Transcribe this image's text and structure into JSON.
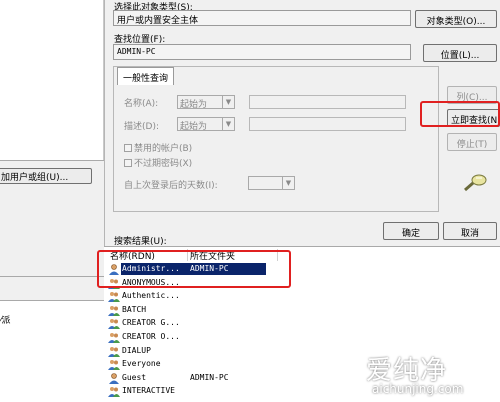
{
  "left_window": {
    "button_label": "加用户或组(U)...",
    "fragment_text": "⁄派"
  },
  "dialog": {
    "object_type_label": "选择此对象类型(S):",
    "object_type_value": "用户或内置安全主体",
    "object_type_button": "对象类型(O)...",
    "location_label": "查找位置(F):",
    "location_value": "ADMIN-PC",
    "location_button": "位置(L)...",
    "tab_label": "一般性查询",
    "name_label": "名称(A):",
    "name_combo": "起始为",
    "desc_label": "描述(D):",
    "desc_combo": "起始为",
    "disabled_accounts_label": "禁用的帐户(B)",
    "nonexpiring_pwd_label": "不过期密码(X)",
    "days_since_login_label": "自上次登录后的天数(I):",
    "columns_button": "列(C)...",
    "find_now_button": "立即查找(N)",
    "stop_button": "停止(T)",
    "ok_button": "确定",
    "cancel_button": "取消",
    "results_label": "搜索结果(U):",
    "results_columns": [
      "名称(RDN)",
      "所在文件夹"
    ],
    "results_rows": [
      {
        "name": "Administr...",
        "folder": "ADMIN-PC",
        "icon": "user-icon",
        "selected": true
      },
      {
        "name": "ANONYMOUS...",
        "folder": "",
        "icon": "group-icon",
        "selected": false
      },
      {
        "name": "Authentic...",
        "folder": "",
        "icon": "group-icon",
        "selected": false
      },
      {
        "name": "BATCH",
        "folder": "",
        "icon": "group-icon",
        "selected": false
      },
      {
        "name": "CREATOR G...",
        "folder": "",
        "icon": "group-icon",
        "selected": false
      },
      {
        "name": "CREATOR O...",
        "folder": "",
        "icon": "group-icon",
        "selected": false
      },
      {
        "name": "DIALUP",
        "folder": "",
        "icon": "group-icon",
        "selected": false
      },
      {
        "name": "Everyone",
        "folder": "",
        "icon": "group-icon",
        "selected": false
      },
      {
        "name": "Guest",
        "folder": "ADMIN-PC",
        "icon": "user-icon",
        "selected": false
      },
      {
        "name": "INTERACTIVE",
        "folder": "",
        "icon": "group-icon",
        "selected": false
      }
    ]
  },
  "watermark": {
    "brand_cn": "爱纯净",
    "brand_url": "aichunjing.com"
  },
  "colors": {
    "selection": "#0a246a",
    "highlight_box": "#e02020",
    "dialog_bg": "#f0f0f0"
  }
}
